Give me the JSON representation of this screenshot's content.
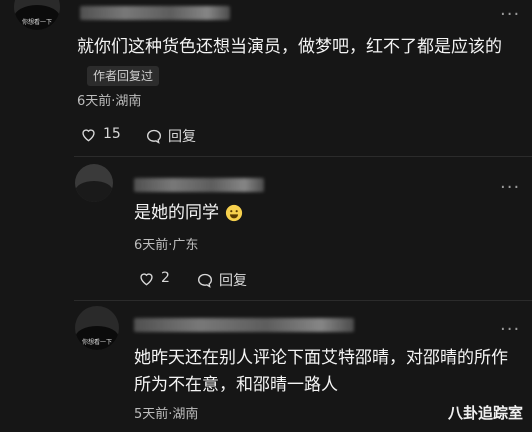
{
  "comments": [
    {
      "avatar_caption": "你想看一下",
      "text": "就你们这种货色还想当演员，做梦吧，红不了都是应该的",
      "badge": "作者回复过",
      "meta": "6天前·湖南",
      "likes": "15",
      "reply_label": "回复"
    },
    {
      "avatar_caption": "",
      "text": "是她的同学",
      "meta": "6天前·广东",
      "likes": "2",
      "reply_label": "回复"
    },
    {
      "avatar_caption": "你想看一下",
      "text_line1": "她昨天还在别人评论下面艾特邵晴，对邵晴的所作",
      "text_line2": "所为不在意，和邵晴一路人",
      "meta": "5天前·湖南"
    }
  ],
  "watermark": "八卦追踪室",
  "more_label": "···"
}
